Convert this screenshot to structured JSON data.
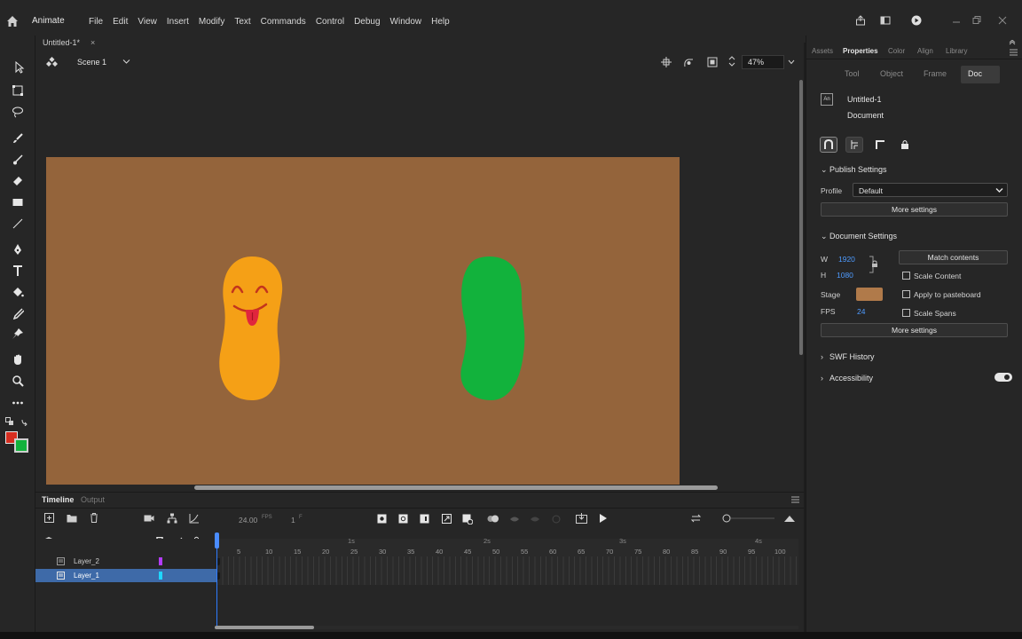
{
  "app": {
    "name": "Animate"
  },
  "menu": [
    "File",
    "Edit",
    "View",
    "Insert",
    "Modify",
    "Text",
    "Commands",
    "Control",
    "Debug",
    "Window",
    "Help"
  ],
  "document_tab": {
    "title": "Untitled-1*"
  },
  "scene": {
    "label": "Scene 1"
  },
  "zoom": {
    "value": "47%"
  },
  "stage": {
    "color": "#94643b"
  },
  "characters": [
    {
      "name": "orange-bean",
      "color": "#f5a016"
    },
    {
      "name": "green-bean",
      "color": "#12b23c"
    }
  ],
  "panel": {
    "tabs": [
      "Assets",
      "Properties",
      "Color",
      "Align",
      "Library"
    ],
    "active_tab": "Properties",
    "subtabs": [
      "Tool",
      "Object",
      "Frame",
      "Doc"
    ],
    "active_subtab": "Doc",
    "doc_name": "Untitled-1",
    "doc_type": "Document",
    "publish_settings": {
      "header": "Publish Settings",
      "profile_label": "Profile",
      "profile_value": "Default",
      "more_settings": "More settings"
    },
    "document_settings": {
      "header": "Document Settings",
      "w_label": "W",
      "w_value": "1920",
      "h_label": "H",
      "h_value": "1080",
      "match_contents": "Match contents",
      "scale_content": "Scale Content",
      "apply_pasteboard": "Apply to pasteboard",
      "scale_spans": "Scale Spans",
      "stage_label": "Stage",
      "stage_color": "#b07a4a",
      "fps_label": "FPS",
      "fps_value": "24",
      "more_settings": "More settings"
    },
    "swf_history": "SWF History",
    "accessibility": "Accessibility"
  },
  "timeline": {
    "tabs": [
      "Timeline",
      "Output"
    ],
    "fps": "24.00",
    "fps_unit": "FPS",
    "frame": "1",
    "frame_unit": "F",
    "layers": [
      {
        "name": "Layer_2",
        "color": "#b43cff",
        "selected": false
      },
      {
        "name": "Layer_1",
        "color": "#1fd6ff",
        "selected": true
      }
    ],
    "frame_numbers": [
      "5",
      "10",
      "15",
      "20",
      "25",
      "30",
      "35",
      "40",
      "45",
      "50",
      "55",
      "60",
      "65",
      "70",
      "75",
      "80",
      "85",
      "90",
      "95",
      "100"
    ],
    "seconds": [
      "1s",
      "2s",
      "3s",
      "4s"
    ]
  }
}
